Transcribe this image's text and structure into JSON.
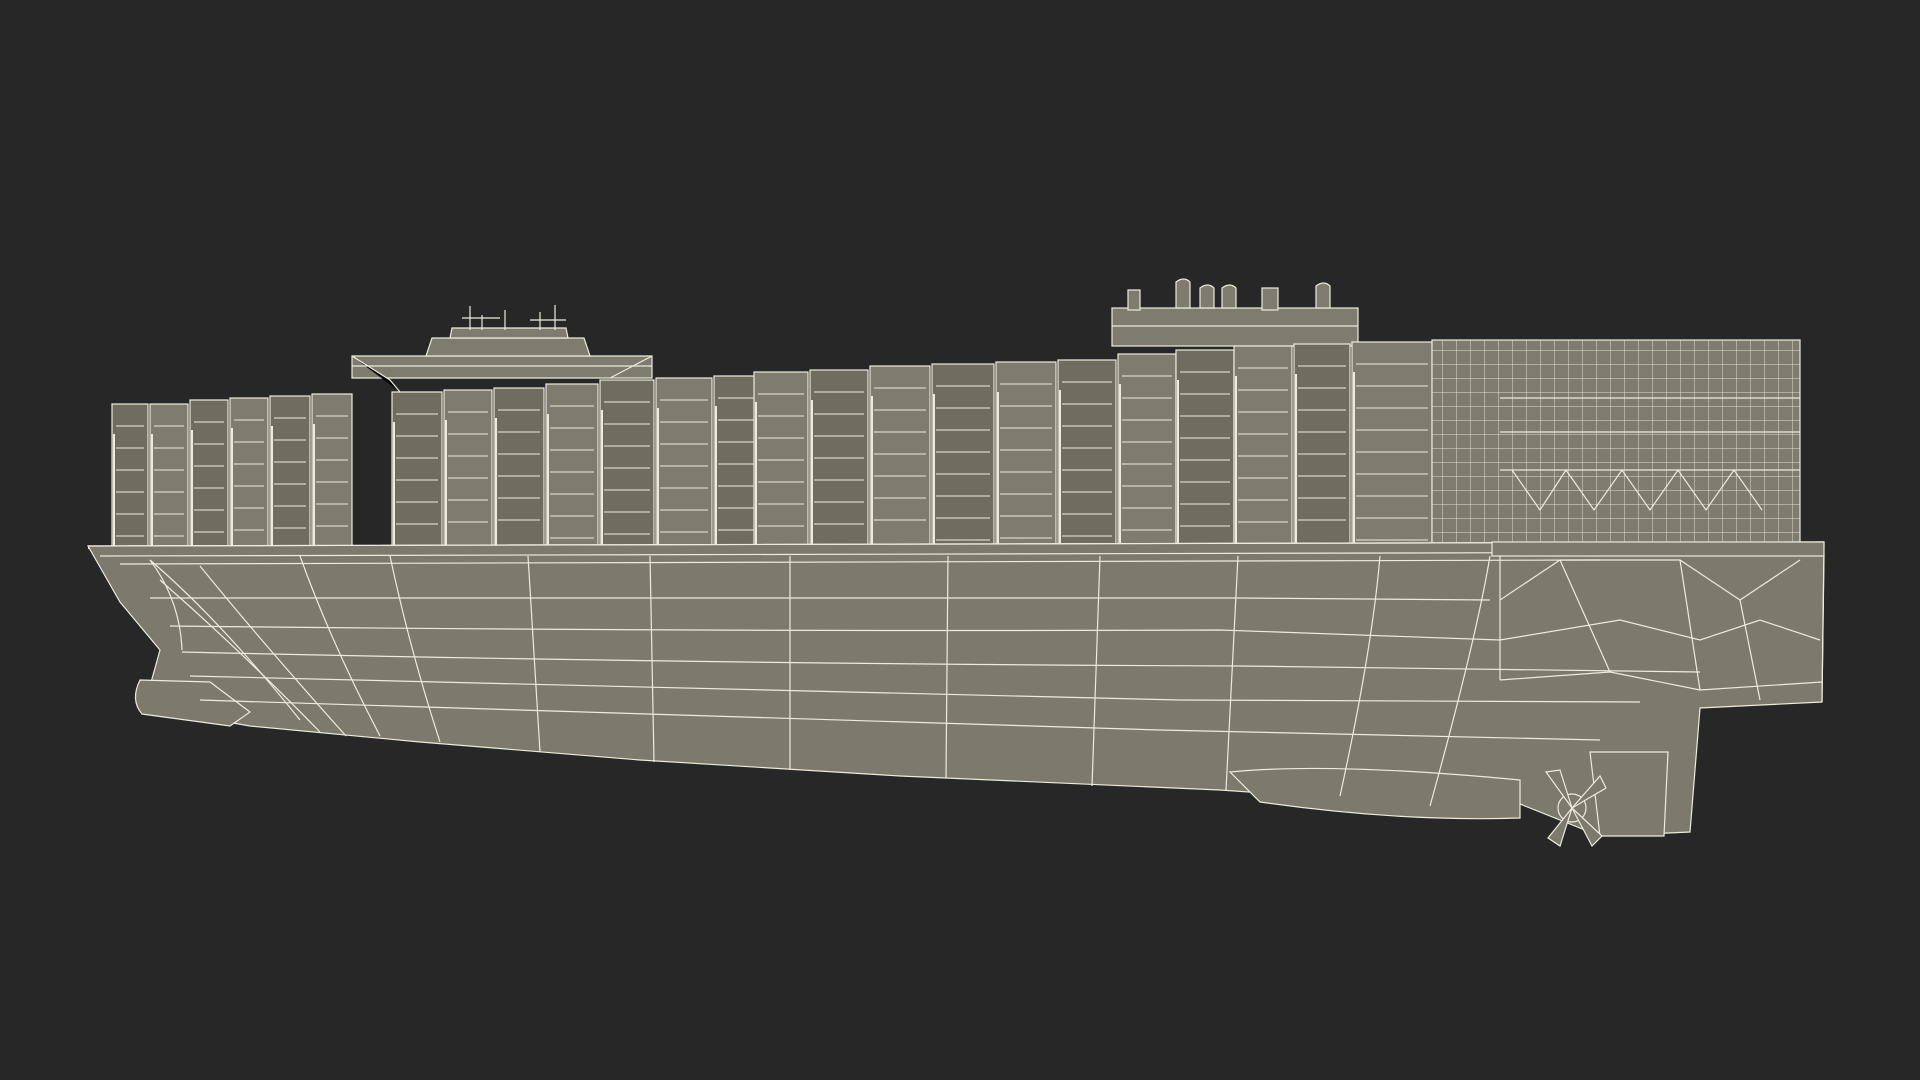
{
  "scene": {
    "subject": "container-ship-wireframe",
    "view": "side-three-quarter",
    "colors": {
      "background": "#272727",
      "hull_fill": "#7b7a6c",
      "container_fill": "#7d7c6e",
      "container_shade": "#6e6d60",
      "wire": "#ecebdc",
      "wire_dim": "#cfcebf"
    }
  }
}
